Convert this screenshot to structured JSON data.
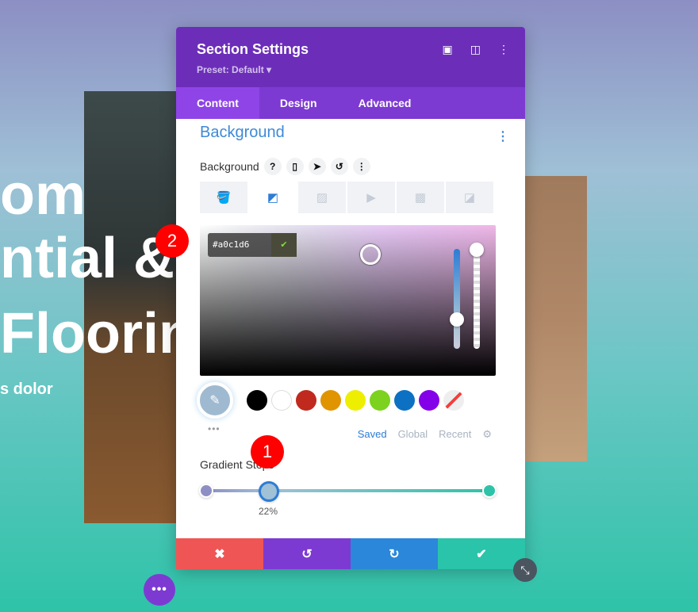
{
  "hero": {
    "line1": "om",
    "line2": "ntial &",
    "line3": "Flooring",
    "line4": "s dolor"
  },
  "panel": {
    "title": "Section Settings",
    "preset": "Preset: Default ▾",
    "header_icons": [
      "focus-icon",
      "split-view-icon",
      "more-vertical-icon"
    ],
    "tabs": [
      {
        "label": "Content",
        "active": true
      },
      {
        "label": "Design"
      },
      {
        "label": "Advanced"
      }
    ],
    "section_title": "Background",
    "background_label": "Background",
    "background_types": [
      "color",
      "gradient",
      "image",
      "video",
      "pattern",
      "mask"
    ],
    "selected_type": "gradient",
    "color_hex": "#a0c1d6",
    "swatches": [
      "#000000",
      "#ffffff",
      "#c0291e",
      "#e09400",
      "#eeee00",
      "#7cd21e",
      "#0c71c3",
      "#8300e9"
    ],
    "palette_tabs": {
      "saved": "Saved",
      "global": "Global",
      "recent": "Recent"
    },
    "gradient_label": "Gradient Stops",
    "gradient_stops": [
      {
        "color": "#8d8fc4",
        "position": 0
      },
      {
        "color": "#a0c1d6",
        "position": 22
      },
      {
        "color": "#2ec3a8",
        "position": 100
      }
    ],
    "selected_stop_label": "22%"
  },
  "footer": {
    "cancel": "✖",
    "undo": "↺",
    "redo": "↻",
    "save": "✔"
  },
  "badges": {
    "one": "1",
    "two": "2"
  }
}
